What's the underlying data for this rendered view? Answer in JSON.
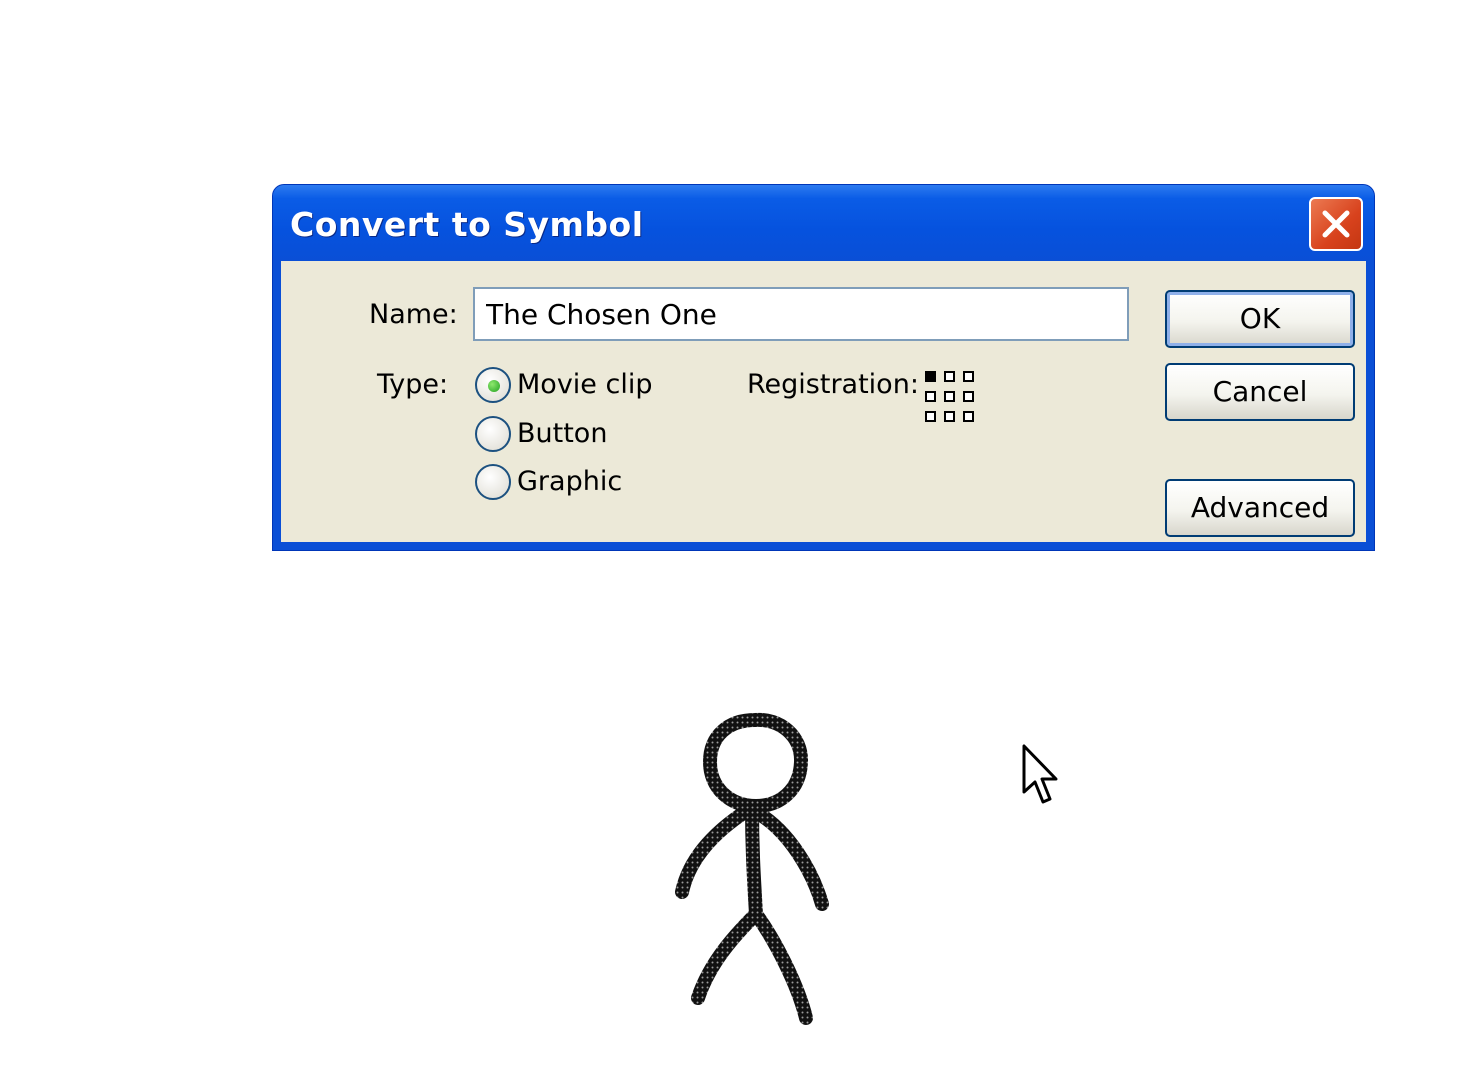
{
  "dialog": {
    "title": "Convert to Symbol",
    "name_label": "Name:",
    "name_value": "The Chosen One",
    "type_label": "Type:",
    "types": [
      "Movie clip",
      "Button",
      "Graphic"
    ],
    "selected_type": "Movie clip",
    "registration_label": "Registration:",
    "buttons": {
      "ok": "OK",
      "cancel": "Cancel",
      "advanced": "Advanced"
    }
  },
  "colors": {
    "titlebar": "#0a4fd6",
    "dialog_bg": "#ece9d8",
    "close": "#d8421d"
  },
  "icons": [
    "close-icon",
    "registration-grid-icon",
    "mouse-pointer-icon",
    "stick-figure"
  ]
}
